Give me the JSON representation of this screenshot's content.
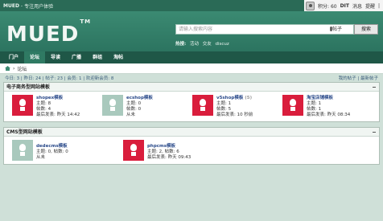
{
  "topbar": {
    "site": "MUED",
    "separator": "-",
    "tagline": "专注用户体验",
    "points": "积分: 60",
    "user": "DIT",
    "messages": "消息",
    "reminders": "提醒",
    "more": "|"
  },
  "header": {
    "logo": "MUED",
    "logo_tm": "TM",
    "search_placeholder": "请输入搜索内容",
    "search_scope": "帖子",
    "search_button": "搜索",
    "hot_label": "热搜:",
    "hot_items": [
      "活动",
      "交友",
      "discuz"
    ]
  },
  "nav": {
    "items": [
      "门户",
      "论坛",
      "导读",
      "广播",
      "群组",
      "淘帖"
    ],
    "active": "论坛"
  },
  "breadcrumb": {
    "home": "home",
    "separator": "›",
    "current": "论坛"
  },
  "stats": {
    "left": "今日: 3 | 昨日: 24 | 帖子: 23 | 会员: 1 | 欢迎新会员: 8",
    "right": "我的帖子 | 最新帖子"
  },
  "sections": [
    {
      "title": "电子商务型网站模板",
      "boards": [
        {
          "name": "shopex模板",
          "topics": "主题: 8",
          "posts": "帖数: 4",
          "last": "最后发表: 昨天 14:42",
          "color": "red"
        },
        {
          "name": "ecshop模板",
          "topics": "主题: 0",
          "posts": "帖数: 0",
          "last": "从未",
          "color": "gray"
        },
        {
          "name": "v5shop模板",
          "badge": "(5)",
          "topics": "主题: 1",
          "posts": "帖数: 5",
          "last": "最后发表: 10 秒前",
          "color": "red"
        },
        {
          "name": "淘宝店铺模板",
          "topics": "主题: 1",
          "posts": "帖数: 1",
          "last": "最后发表: 昨天 08:34",
          "color": "red"
        }
      ]
    },
    {
      "title": "CMS型网站模板",
      "boards": [
        {
          "name": "dedecms模板",
          "topics": "主题: 0",
          "posts": "帖数: 0",
          "last": "从未",
          "color": "gray"
        },
        {
          "name": "phpcms模板",
          "topics": "主题: 2",
          "posts": "帖数: 6",
          "last": "最后发表: 昨天 09:43",
          "color": "red"
        }
      ]
    }
  ],
  "colors": {
    "brand": "#2a6a56",
    "nav": "#1f5747",
    "board_new": "#d91d3c",
    "board_empty": "#a9c9bd"
  }
}
